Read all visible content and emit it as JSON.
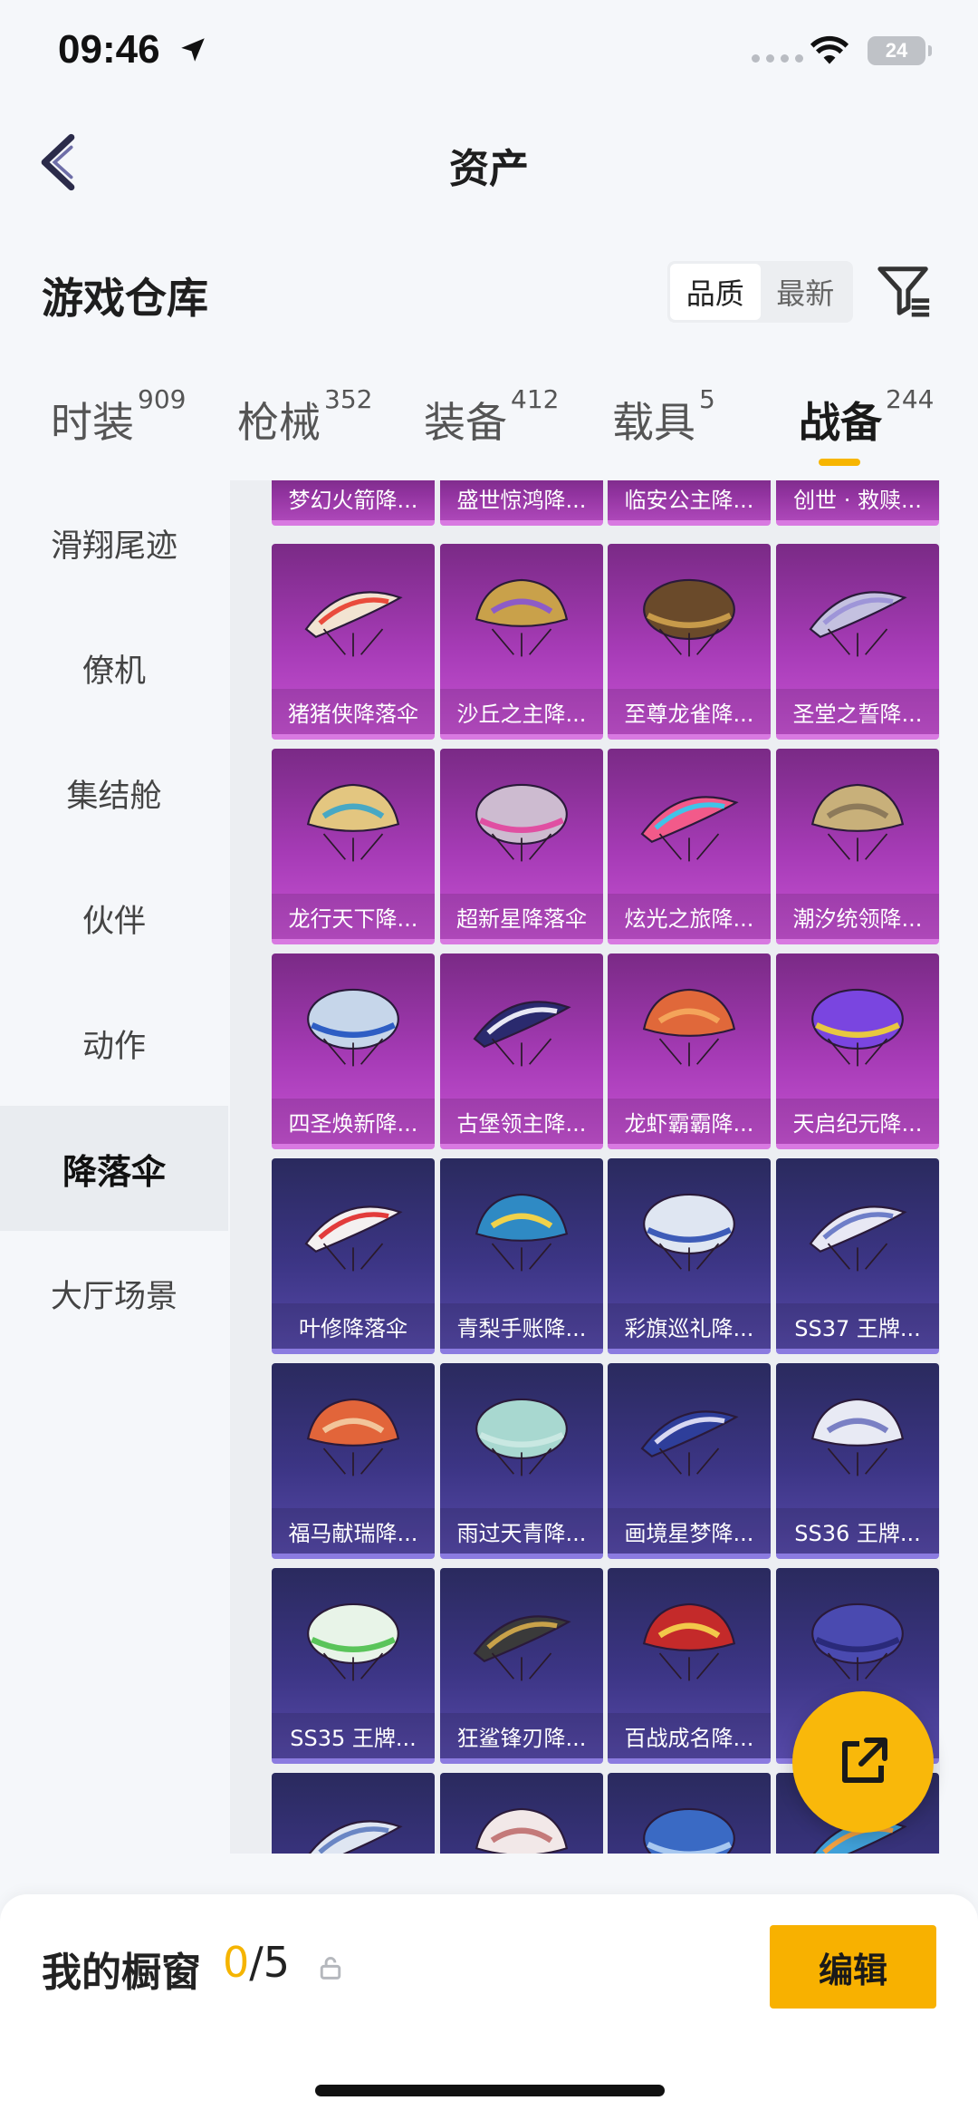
{
  "status_bar": {
    "time": "09:46",
    "battery": "24"
  },
  "nav": {
    "title": "资产"
  },
  "section": {
    "title": "游戏仓库"
  },
  "sort": {
    "options": [
      "品质",
      "最新"
    ],
    "selected": "品质"
  },
  "tabs": [
    {
      "label": "时装",
      "count": "909"
    },
    {
      "label": "枪械",
      "count": "352"
    },
    {
      "label": "装备",
      "count": "412"
    },
    {
      "label": "载具",
      "count": "5"
    },
    {
      "label": "战备",
      "count": "244",
      "active": true
    }
  ],
  "categories": [
    "滑翔尾迹",
    "僚机",
    "集结舱",
    "伙伴",
    "动作",
    "降落伞",
    "大厅场景"
  ],
  "active_category": "降落伞",
  "items": [
    {
      "name": "梦幻火箭降...",
      "tier": "purple"
    },
    {
      "name": "盛世惊鸿降...",
      "tier": "purple"
    },
    {
      "name": "临安公主降...",
      "tier": "purple"
    },
    {
      "name": "创世 · 救赎...",
      "tier": "purple"
    },
    {
      "name": "猪猪侠降落伞",
      "tier": "purple"
    },
    {
      "name": "沙丘之主降...",
      "tier": "purple"
    },
    {
      "name": "至尊龙雀降...",
      "tier": "purple"
    },
    {
      "name": "圣堂之誓降...",
      "tier": "purple"
    },
    {
      "name": "龙行天下降...",
      "tier": "purple"
    },
    {
      "name": "超新星降落伞",
      "tier": "purple"
    },
    {
      "name": "炫光之旅降...",
      "tier": "purple"
    },
    {
      "name": "潮汐统领降...",
      "tier": "purple"
    },
    {
      "name": "四圣焕新降...",
      "tier": "purple"
    },
    {
      "name": "古堡领主降...",
      "tier": "purple"
    },
    {
      "name": "龙虾霸霸降...",
      "tier": "purple"
    },
    {
      "name": "天启纪元降...",
      "tier": "purple"
    },
    {
      "name": "叶修降落伞",
      "tier": "blue"
    },
    {
      "name": "青梨手账降...",
      "tier": "blue"
    },
    {
      "name": "彩旗巡礼降...",
      "tier": "blue"
    },
    {
      "name": "SS37 王牌...",
      "tier": "blue"
    },
    {
      "name": "福马献瑞降...",
      "tier": "blue"
    },
    {
      "name": "雨过天青降...",
      "tier": "blue"
    },
    {
      "name": "画境星梦降...",
      "tier": "blue"
    },
    {
      "name": "SS36 王牌...",
      "tier": "blue"
    },
    {
      "name": "SS35 王牌...",
      "tier": "blue"
    },
    {
      "name": "狂鲨锋刃降...",
      "tier": "blue"
    },
    {
      "name": "百战成名降...",
      "tier": "blue"
    },
    {
      "name": "",
      "tier": "blue"
    },
    {
      "name": "",
      "tier": "blue"
    },
    {
      "name": "",
      "tier": "blue"
    },
    {
      "name": "",
      "tier": "blue"
    },
    {
      "name": "",
      "tier": "blue"
    }
  ],
  "showcase": {
    "label": "我的橱窗",
    "filled": "0",
    "total": "/5",
    "edit_label": "编辑"
  },
  "colors": {
    "accent": "#f8b100",
    "purple_tier": "#a63bb6",
    "blue_tier": "#3c3585"
  }
}
